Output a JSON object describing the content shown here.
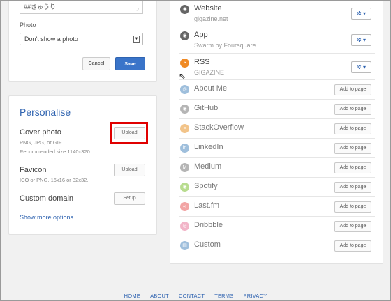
{
  "profile_form": {
    "textarea_value": "##きゅうり",
    "photo_label": "Photo",
    "photo_select_value": "Don't show a photo",
    "cancel_label": "Cancel",
    "save_label": "Save"
  },
  "personalise": {
    "title": "Personalise",
    "cover_photo": {
      "label": "Cover photo",
      "hint1": "PNG, JPG, or GIF.",
      "hint2": "Recommended size 1140x320.",
      "button": "Upload"
    },
    "favicon": {
      "label": "Favicon",
      "hint": "ICO or PNG. 16x16 or 32x32.",
      "button": "Upload"
    },
    "custom_domain": {
      "label": "Custom domain",
      "button": "Setup"
    },
    "show_more": "Show more options..."
  },
  "services_connected": [
    {
      "name": "Website",
      "sub": "gigazine.net",
      "icon": "globe-icon",
      "color": "#666666",
      "glyph": "◉"
    },
    {
      "name": "App",
      "sub": "Swarm by Foursquare",
      "icon": "app-icon",
      "color": "#666666",
      "glyph": "◉"
    },
    {
      "name": "RSS",
      "sub": "GIGAZINE",
      "icon": "rss-icon",
      "color": "#f08a24",
      "glyph": "◔"
    }
  ],
  "gear_label": "✲ ▾",
  "services_available": [
    {
      "name": "About Me",
      "icon": "aboutme-icon",
      "color": "#9fbfdc",
      "glyph": "◎"
    },
    {
      "name": "GitHub",
      "icon": "github-icon",
      "color": "#b5b5b5",
      "glyph": "◉"
    },
    {
      "name": "StackOverflow",
      "icon": "stackoverflow-icon",
      "color": "#f2c48a",
      "glyph": "≡"
    },
    {
      "name": "LinkedIn",
      "icon": "linkedin-icon",
      "color": "#9fbfdc",
      "glyph": "in"
    },
    {
      "name": "Medium",
      "icon": "medium-icon",
      "color": "#b5b5b5",
      "glyph": "M"
    },
    {
      "name": "Spotify",
      "icon": "spotify-icon",
      "color": "#b8dc8f",
      "glyph": "◉"
    },
    {
      "name": "Last.fm",
      "icon": "lastfm-icon",
      "color": "#f2a5a5",
      "glyph": "∞"
    },
    {
      "name": "Dribbble",
      "icon": "dribbble-icon",
      "color": "#f2b5c8",
      "glyph": "◎"
    },
    {
      "name": "Custom",
      "icon": "custom-icon",
      "color": "#9fbfdc",
      "glyph": "▤"
    }
  ],
  "add_label": "Add to page",
  "footer": [
    "HOME",
    "ABOUT",
    "CONTACT",
    "TERMS",
    "PRIVACY"
  ]
}
